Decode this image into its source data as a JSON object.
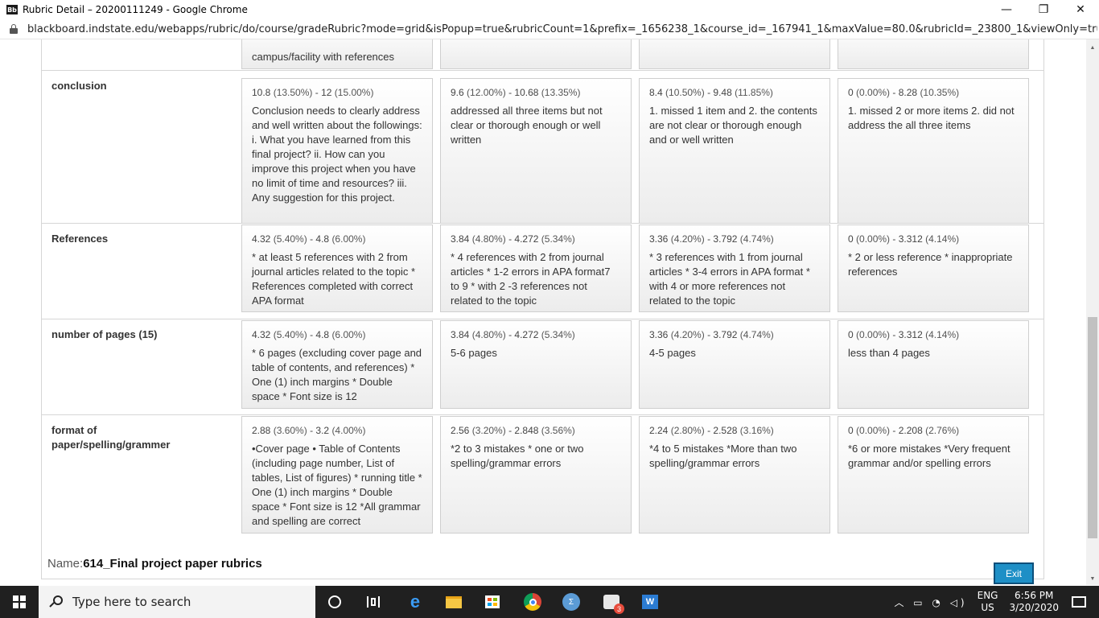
{
  "window": {
    "title": "Rubric Detail – 20200111249 - Google Chrome",
    "logo_text": "Bb",
    "minimize": "—",
    "restore": "❐",
    "close": "✕"
  },
  "address": {
    "url": "blackboard.indstate.edu/webapps/rubric/do/course/gradeRubric?mode=grid&isPopup=true&rubricCount=1&prefix=_1656238_1&course_id=_167941_1&maxValue=80.0&rubricId=_23800_1&viewOnly=true&dis..."
  },
  "rubric": {
    "partial_row": {
      "cells": [
        {
          "desc": "campus/facility with references"
        },
        {
          "desc": ""
        },
        {
          "desc": ""
        },
        {
          "desc": ""
        }
      ]
    },
    "rows": [
      {
        "criterion": "conclusion",
        "cells": [
          {
            "pts": "10.8",
            "pct1": "(13.50%)",
            "pts2": "12",
            "pct2": "(15.00%)",
            "desc": "Conclusion needs to clearly address and well written about the followings: i. What you have learned from this final project? ii. How can you improve this project when you have no limit of time and resources? iii. Any suggestion for this project."
          },
          {
            "pts": "9.6",
            "pct1": "(12.00%)",
            "pts2": "10.68",
            "pct2": "(13.35%)",
            "desc": "addressed all three items but not clear or thorough enough or well written"
          },
          {
            "pts": "8.4",
            "pct1": "(10.50%)",
            "pts2": "9.48",
            "pct2": "(11.85%)",
            "desc": "1. missed 1 item and 2. the contents are not clear or thorough enough and or well written"
          },
          {
            "pts": "0",
            "pct1": "(0.00%)",
            "pts2": "8.28",
            "pct2": "(10.35%)",
            "desc": "1. missed 2 or more items 2. did not address the all three items"
          }
        ]
      },
      {
        "criterion": "References",
        "cells": [
          {
            "pts": "4.32",
            "pct1": "(5.40%)",
            "pts2": "4.8",
            "pct2": "(6.00%)",
            "desc": "* at least 5 references with 2 from journal articles related to the topic * References completed with correct APA format"
          },
          {
            "pts": "3.84",
            "pct1": "(4.80%)",
            "pts2": "4.272",
            "pct2": "(5.34%)",
            "desc": "* 4 references with 2 from journal articles * 1-2 errors in APA format7 to 9 * with 2 -3 references not related to the topic"
          },
          {
            "pts": "3.36",
            "pct1": "(4.20%)",
            "pts2": "3.792",
            "pct2": "(4.74%)",
            "desc": "* 3 references with 1 from journal articles * 3-4 errors in APA format * with 4 or more references not related to the topic"
          },
          {
            "pts": "0",
            "pct1": "(0.00%)",
            "pts2": "3.312",
            "pct2": "(4.14%)",
            "desc": "* 2 or less reference * inappropriate references"
          }
        ]
      },
      {
        "criterion": "number of pages (15)",
        "cells": [
          {
            "pts": "4.32",
            "pct1": "(5.40%)",
            "pts2": "4.8",
            "pct2": "(6.00%)",
            "desc": "* 6 pages (excluding cover page and table of contents, and references) * One (1) inch margins * Double space * Font size is 12"
          },
          {
            "pts": "3.84",
            "pct1": "(4.80%)",
            "pts2": "4.272",
            "pct2": "(5.34%)",
            "desc": "5-6 pages"
          },
          {
            "pts": "3.36",
            "pct1": "(4.20%)",
            "pts2": "3.792",
            "pct2": "(4.74%)",
            "desc": "4-5 pages"
          },
          {
            "pts": "0",
            "pct1": "(0.00%)",
            "pts2": "3.312",
            "pct2": "(4.14%)",
            "desc": "less than 4 pages"
          }
        ]
      },
      {
        "criterion": "format of paper/spelling/grammer",
        "cells": [
          {
            "pts": "2.88",
            "pct1": "(3.60%)",
            "pts2": "3.2",
            "pct2": "(4.00%)",
            "desc": "•Cover page • Table of Contents (including page number, List of tables, List of figures) * running title * One (1) inch margins * Double space * Font size is 12 *All grammar and spelling are correct"
          },
          {
            "pts": "2.56",
            "pct1": "(3.20%)",
            "pts2": "2.848",
            "pct2": "(3.56%)",
            "desc": "*2 to 3 mistakes * one or two spelling/grammar errors"
          },
          {
            "pts": "2.24",
            "pct1": "(2.80%)",
            "pts2": "2.528",
            "pct2": "(3.16%)",
            "desc": "*4 to 5 mistakes *More than two spelling/grammar errors"
          },
          {
            "pts": "0",
            "pct1": "(0.00%)",
            "pts2": "2.208",
            "pct2": "(2.76%)",
            "desc": "*6 or more mistakes *Very frequent grammar and/or spelling errors"
          }
        ]
      }
    ],
    "name_label": "Name:",
    "name_value": "614_Final project paper rubrics",
    "exit_label": "Exit"
  },
  "taskbar": {
    "search_placeholder": "Type here to search",
    "lang_top": "ENG",
    "lang_bottom": "US",
    "time": "6:56 PM",
    "date": "3/20/2020",
    "badge_count": "3"
  }
}
